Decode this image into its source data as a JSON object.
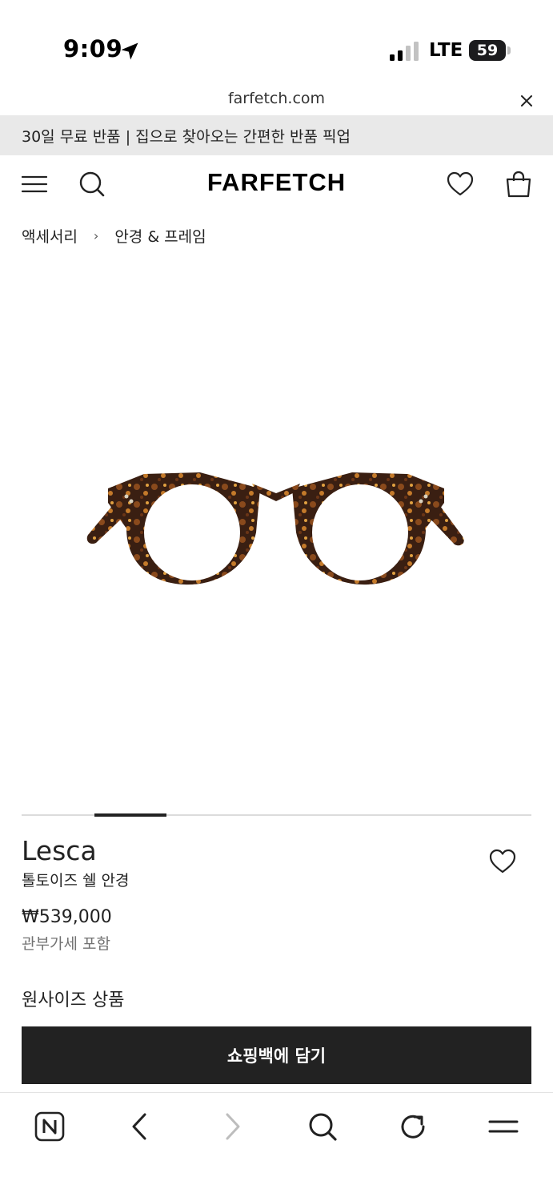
{
  "status_bar": {
    "time": "9:09",
    "network": "LTE",
    "battery": "59"
  },
  "browser": {
    "url": "farfetch.com"
  },
  "promo_banner": {
    "text": "30일 무료 반품 | 집으로 찾아오는 간편한 반품 픽업"
  },
  "header": {
    "logo": "FARFETCH"
  },
  "breadcrumb": {
    "items": [
      "액세서리",
      "안경 & 프레임"
    ],
    "separator": "›"
  },
  "product": {
    "brand": "Lesca",
    "name": "톨토이즈 쉘 안경",
    "price": "₩539,000",
    "tax_note": "관부가세 포함",
    "size_note": "원사이즈 상품",
    "add_to_bag_label": "쇼핑백에 담기",
    "gallery_active_index": 2
  },
  "icons": {
    "header": [
      "menu-icon",
      "search-icon",
      "heart-icon",
      "shopping-bag-icon"
    ],
    "toolbar": [
      "naver-home-icon",
      "back-icon",
      "forward-icon",
      "search-icon",
      "reload-icon",
      "menu-icon"
    ]
  },
  "colors": {
    "button": "#222222",
    "banner": "#e9e9e9",
    "muted_text": "#727272"
  }
}
